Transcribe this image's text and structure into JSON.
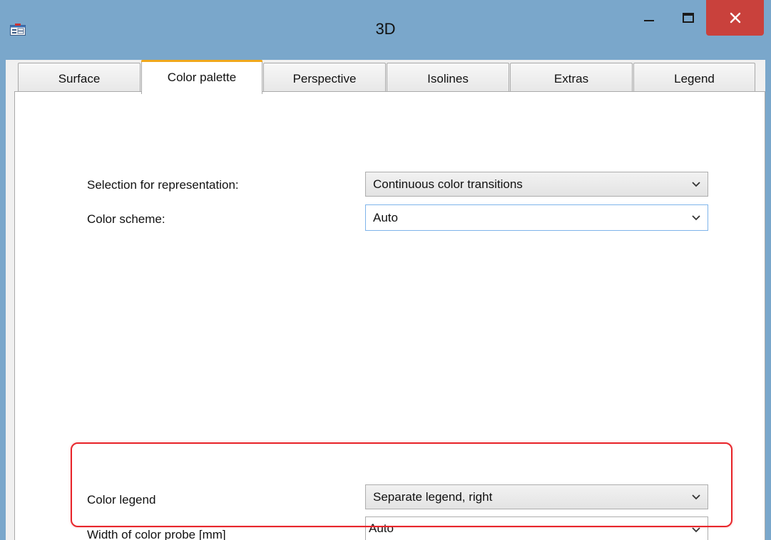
{
  "window": {
    "title": "3D",
    "icons": {
      "app": "dialog-icon",
      "minimize": "minimize-icon",
      "maximize": "maximize-icon",
      "close": "close-icon"
    }
  },
  "tabs": [
    {
      "label": "Surface",
      "active": false
    },
    {
      "label": "Color palette",
      "active": true
    },
    {
      "label": "Perspective",
      "active": false
    },
    {
      "label": "Isolines",
      "active": false
    },
    {
      "label": "Extras",
      "active": false
    },
    {
      "label": "Legend",
      "active": false
    }
  ],
  "form": {
    "representation": {
      "label": "Selection for representation:",
      "value": "Continuous color transitions"
    },
    "color_scheme": {
      "label": "Color scheme:",
      "value": "Auto"
    },
    "color_legend": {
      "label": "Color legend",
      "value": "Separate legend, right"
    },
    "probe_width": {
      "label": "Width of color probe [mm]",
      "value": "Auto"
    }
  },
  "colors": {
    "titlebar": "#7aa7cb",
    "close_button": "#c9413c",
    "active_tab_accent": "#f0a81c",
    "highlight_border": "#e8262b"
  }
}
